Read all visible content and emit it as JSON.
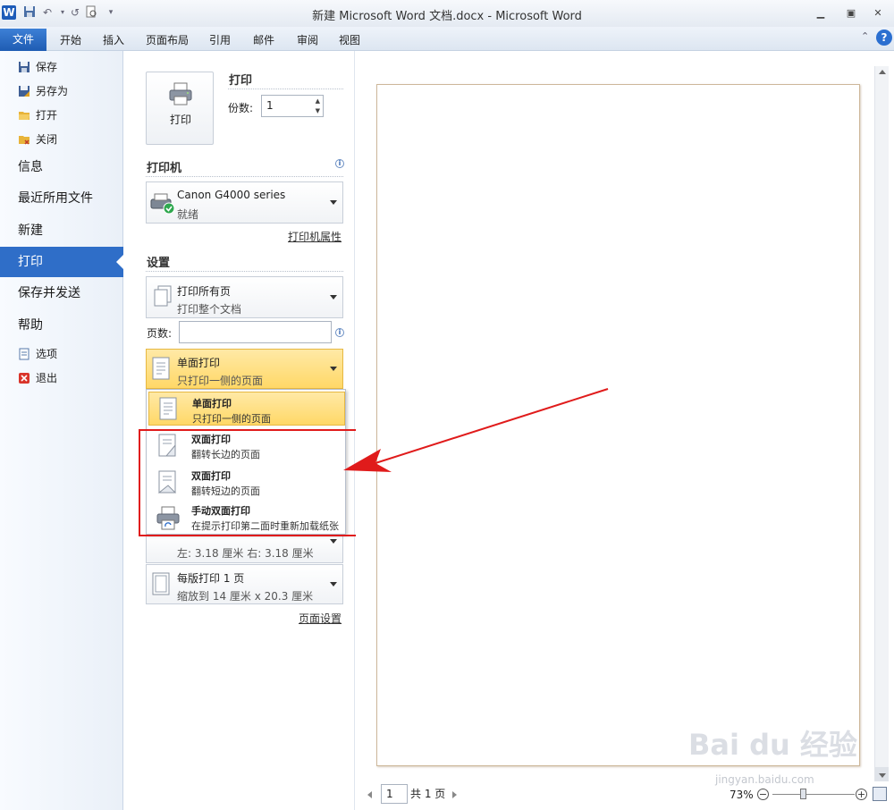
{
  "window": {
    "title": "新建 Microsoft Word 文档.docx - Microsoft Word",
    "app_logo": "W"
  },
  "ribbon": {
    "tabs": [
      "文件",
      "开始",
      "插入",
      "页面布局",
      "引用",
      "邮件",
      "审阅",
      "视图"
    ]
  },
  "nav": {
    "small_items": [
      "保存",
      "另存为",
      "打开",
      "关闭"
    ],
    "big_items": [
      "信息",
      "最近所用文件",
      "新建",
      "打印",
      "保存并发送",
      "帮助"
    ],
    "bottom_items": [
      "选项",
      "退出"
    ],
    "active": "打印"
  },
  "print": {
    "section_title": "打印",
    "button_label": "打印",
    "copies_label": "份数:",
    "copies_value": "1"
  },
  "printer": {
    "section_title": "打印机",
    "name": "Canon G4000 series",
    "status": "就绪",
    "properties_link": "打印机属性"
  },
  "settings": {
    "section_title": "设置",
    "range": {
      "title": "打印所有页",
      "subtitle": "打印整个文档"
    },
    "pages_label": "页数:",
    "pages_value": "",
    "sides": {
      "title": "单面打印",
      "subtitle": "只打印一侧的页面"
    },
    "margins_partial": "左: 3.18 厘米    右: 3.18 厘米",
    "per_page": {
      "title": "每版打印 1 页",
      "subtitle": "缩放到 14 厘米 x 20.3 厘米"
    },
    "page_setup_link": "页面设置"
  },
  "sides_menu": [
    {
      "title": "单面打印",
      "subtitle": "只打印一侧的页面",
      "selected": true
    },
    {
      "title": "双面打印",
      "subtitle": "翻转长边的页面",
      "selected": false
    },
    {
      "title": "双面打印",
      "subtitle": "翻转短边的页面",
      "selected": false
    },
    {
      "title": "手动双面打印",
      "subtitle": "在提示打印第二面时重新加载纸张",
      "selected": false
    }
  ],
  "preview": {
    "current_page": "1",
    "total_pages": "共 1 页",
    "zoom": "73%",
    "zoom_level": 0.37
  },
  "watermark": {
    "text": "Bai du 经验",
    "sub": "jingyan.baidu.com"
  },
  "colors": {
    "accent": "#2f6ec8",
    "highlight": "#ffd867",
    "annotation": "#e01b1b"
  }
}
